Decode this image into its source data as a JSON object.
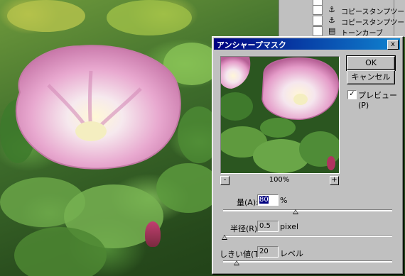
{
  "history_palette": {
    "items": [
      {
        "label": "コピースタンプツール",
        "icon": "stamp-icon"
      },
      {
        "label": "コピースタンプツール",
        "icon": "stamp-icon"
      },
      {
        "label": "トーンカーブ",
        "icon": "curves-icon"
      }
    ]
  },
  "dialog": {
    "title": "アンシャープマスク",
    "close_label": "x",
    "ok_label": "OK",
    "cancel_label": "キャンセル",
    "preview_label": "プレビュー(P)",
    "preview_checked": true,
    "zoom_level": "100%",
    "zoom_minus": "-",
    "zoom_plus": "+",
    "amount": {
      "label": "量(A):",
      "value": "80",
      "unit": "%",
      "level": 0.43
    },
    "radius": {
      "label": "半径(R):",
      "value": "0.5",
      "unit": "pixel",
      "level": 0.01
    },
    "threshold": {
      "label": "しきい値(T):",
      "value": "20",
      "unit": "レベル",
      "level": 0.08
    }
  },
  "colors": {
    "titlebar": "#000080",
    "dialog_face": "#c0c0c0",
    "flower_pink": "#e8a8cf"
  }
}
